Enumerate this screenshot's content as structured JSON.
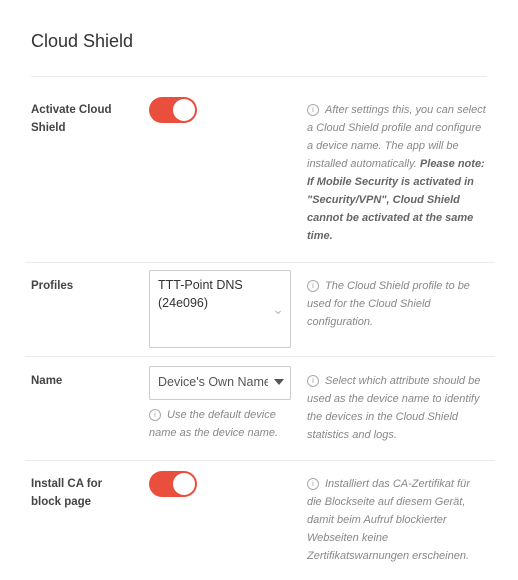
{
  "page": {
    "title": "Cloud Shield"
  },
  "rows": {
    "activate": {
      "label": "Activate Cloud Shield",
      "toggle_state": "on",
      "help_text": "After settings this, you can select a Cloud Shield profile and configure a device name. The app will be installed automatically.",
      "help_note": "Please note: If Mobile Security is activated in \"Security/VPN\", Cloud Shield cannot be activated at the same time."
    },
    "profiles": {
      "label": "Profiles",
      "selected": "TTT-Point DNS (24e096)",
      "help_text": "The Cloud Shield profile to be used for the Cloud Shield configuration."
    },
    "name": {
      "label": "Name",
      "selected": "Device's Own Name",
      "sub_help": "Use the default device name as the device name.",
      "help_text": "Select which attribute should be used as the device name to identify the devices in the Cloud Shield statistics and logs."
    },
    "install_ca": {
      "label": "Install CA for block page",
      "toggle_state": "on",
      "help_text": "Installiert das CA-Zertifikat für die Blockseite auf diesem Gerät, damit beim Aufruf blockierter Webseiten keine Zertifikatswarnungen erscheinen."
    }
  },
  "colors": {
    "toggle_on": "#ea4e3d"
  },
  "icons": {
    "help": "info-circle-icon",
    "multiselect": "chevron-down-icon",
    "select": "caret-down-icon"
  }
}
